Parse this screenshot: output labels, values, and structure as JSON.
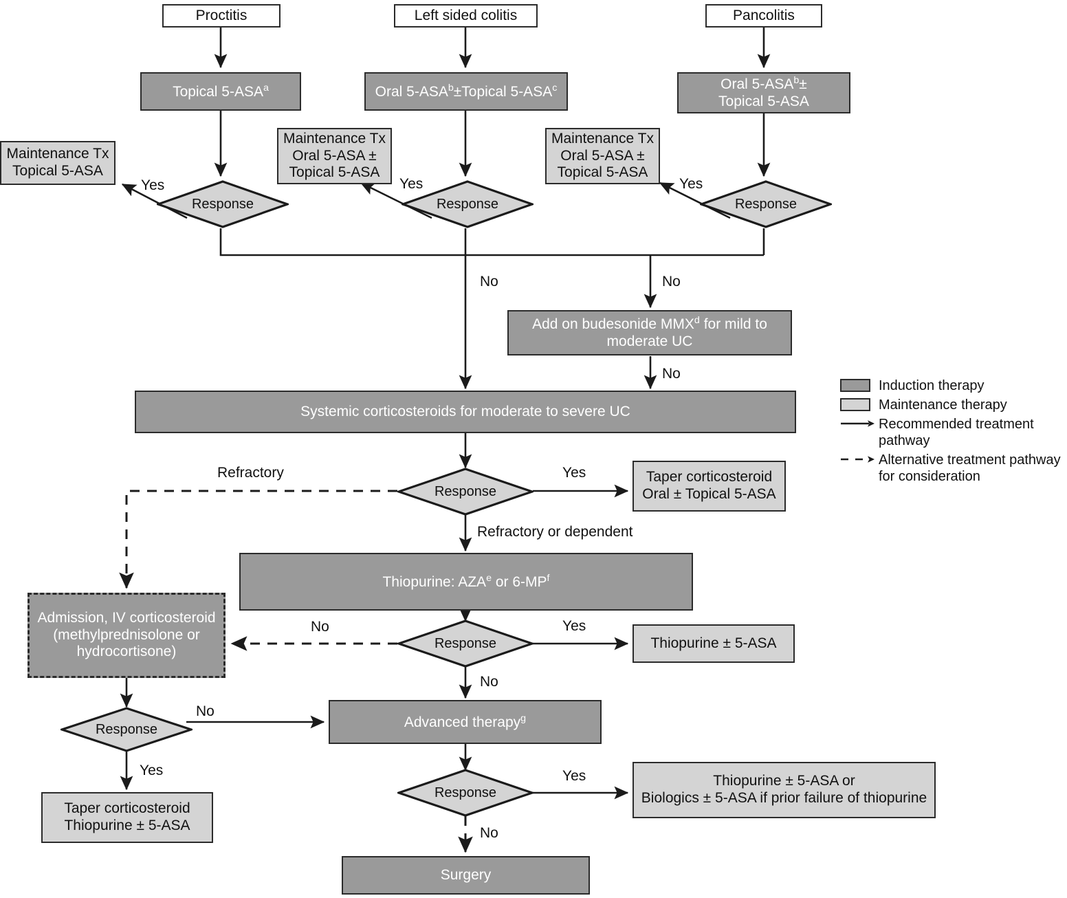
{
  "title": "Ulcerative colitis treatment algorithm flowchart",
  "nodes": {
    "proctitis": "Proctitis",
    "left_sided_colitis": "Left sided colitis",
    "pancolitis": "Pancolitis",
    "topical_5asa": "Topical 5-ASA",
    "topical_5asa_sup": "a",
    "oral_topical_5asa_left_1": "Oral 5-ASA",
    "oral_topical_5asa_left_sup1": "b",
    "oral_topical_5asa_left_2": "±Topical 5-ASA",
    "oral_topical_5asa_left_sup2": "c",
    "oral_topical_pan_1": "Oral 5-ASA",
    "oral_topical_pan_sup": "b",
    "oral_topical_pan_2": "±",
    "oral_topical_pan_3": "Topical 5-ASA",
    "maint_topical": "Maintenance Tx\nTopical 5-ASA",
    "maint_oral_topical_left": "Maintenance Tx\nOral 5-ASA ±\nTopical 5-ASA",
    "maint_oral_topical_pan": "Maintenance Tx\nOral 5-ASA ±\nTopical 5-ASA",
    "budesonide_1": "Add on budesonide MMX",
    "budesonide_sup": "d",
    "budesonide_2": " for mild to moderate UC",
    "systemic_cs": "Systemic corticosteroids for moderate to severe UC",
    "taper_cs_oral": "Taper corticosteroid\nOral ± Topical 5-ASA",
    "thiopurine_1": "Thiopurine: AZA",
    "thiopurine_sup_e": "e",
    "thiopurine_2": " or 6-MP",
    "thiopurine_sup_f": "f",
    "admission_iv": "Admission, IV corticosteroid\n(methylprednisolone or\nhydrocortisone)",
    "thiopurine_5asa": "Thiopurine ± 5-ASA",
    "advanced_therapy": "Advanced therapy",
    "advanced_therapy_sup": "g",
    "taper_cs_thiopurine": "Taper corticosteroid\nThiopurine ± 5-ASA",
    "thiopurine_or_biologics": "Thiopurine ± 5-ASA or\nBiologics ± 5-ASA if prior failure of thiopurine",
    "surgery": "Surgery",
    "response": "Response"
  },
  "edge_labels": {
    "yes_proctitis": "Yes",
    "yes_left": "Yes",
    "yes_pan": "Yes",
    "no_mid_left": "No",
    "no_mid_right": "No",
    "no_budesonide": "No",
    "refractory": "Refractory",
    "yes_systemic": "Yes",
    "refractory_or_dependent": "Refractory or dependent",
    "no_thiopurine_left": "No",
    "yes_thiopurine": "Yes",
    "no_thiopurine_down": "No",
    "no_admission_response": "No",
    "yes_admission_response": "Yes",
    "yes_advanced": "Yes",
    "no_advanced": "No"
  },
  "legend": {
    "items": [
      {
        "key": "induction-swatch",
        "label": "Induction therapy"
      },
      {
        "key": "maintenance-swatch",
        "label": "Maintenance therapy"
      },
      {
        "key": "solid-arrow",
        "label": "Recommended treatment pathway"
      },
      {
        "key": "dashed-arrow",
        "label": "Alternative treatment pathway for consideration"
      }
    ],
    "induction_label": "Induction therapy",
    "maintenance_label": "Maintenance therapy",
    "recommended_label": "Recommended treatment pathway",
    "alternative_label": "Alternative treatment pathway for consideration"
  },
  "colors": {
    "induction_fill": "#9a9a9a",
    "maintenance_fill": "#d4d4d4",
    "plain_fill": "#ffffff",
    "stroke": "#2b2b2b",
    "induction_text": "#ffffff",
    "body_text": "#111111"
  }
}
